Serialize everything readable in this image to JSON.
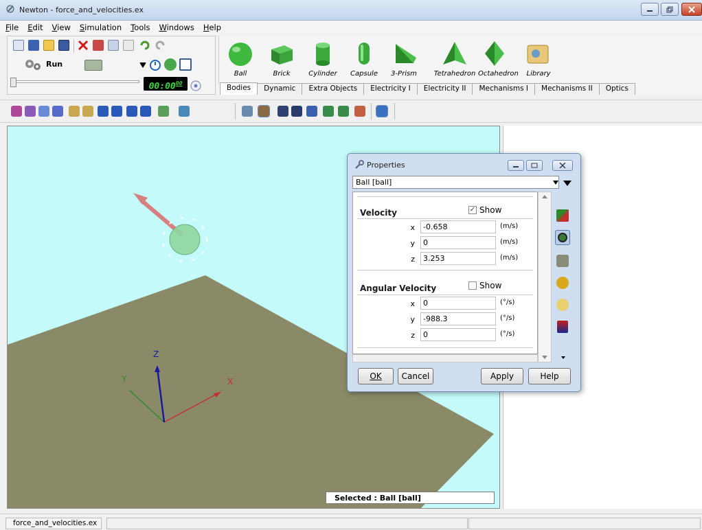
{
  "window": {
    "title": "Newton - force_and_velocities.ex"
  },
  "menu": [
    "File",
    "Edit",
    "View",
    "Simulation",
    "Tools",
    "Windows",
    "Help"
  ],
  "menu_access": [
    "F",
    "E",
    "V",
    "S",
    "T",
    "W",
    "H"
  ],
  "toolbar": {
    "run_label": "Run",
    "timer_main": "00:00",
    "timer_sub": "00"
  },
  "objects": [
    {
      "label": "Ball",
      "icon": "ball-icon"
    },
    {
      "label": "Brick",
      "icon": "brick-icon"
    },
    {
      "label": "Cylinder",
      "icon": "cylinder-icon"
    },
    {
      "label": "Capsule",
      "icon": "capsule-icon"
    },
    {
      "label": "3-Prism",
      "icon": "prism-icon"
    },
    {
      "label": "Tetrahedron",
      "icon": "tetrahedron-icon"
    },
    {
      "label": "Octahedron",
      "icon": "octahedron-icon"
    },
    {
      "label": "Library",
      "icon": "library-icon"
    }
  ],
  "tabs": [
    "Bodies",
    "Dynamic",
    "Extra Objects",
    "Electricity I",
    "Electricity II",
    "Mechanisms I",
    "Mechanisms II",
    "Optics"
  ],
  "viewport": {
    "selected_text": "Selected : Ball [ball]",
    "axis_x": "X",
    "axis_y": "Y",
    "axis_z": "Z",
    "background_color": "#c4fbfa",
    "floor_color": "#8b8a68"
  },
  "properties": {
    "title": "Properties",
    "object_select": "Ball [ball]",
    "velocity": {
      "heading": "Velocity",
      "show_label": "Show",
      "show_checked": true,
      "fields": [
        {
          "axis": "x",
          "value": "-0.658",
          "unit": "(m/s)"
        },
        {
          "axis": "y",
          "value": "0",
          "unit": "(m/s)"
        },
        {
          "axis": "z",
          "value": "3.253",
          "unit": "(m/s)"
        }
      ]
    },
    "angular": {
      "heading": "Angular Velocity",
      "show_label": "Show",
      "show_checked": false,
      "fields": [
        {
          "axis": "x",
          "value": "0",
          "unit": "(°/s)"
        },
        {
          "axis": "y",
          "value": "-988.3",
          "unit": "(°/s)"
        },
        {
          "axis": "z",
          "value": "0",
          "unit": "(°/s)"
        }
      ]
    },
    "buttons": {
      "ok": "OK",
      "cancel": "Cancel",
      "apply": "Apply",
      "help": "Help"
    }
  },
  "statusbar": {
    "file": "force_and_velocities.ex"
  }
}
